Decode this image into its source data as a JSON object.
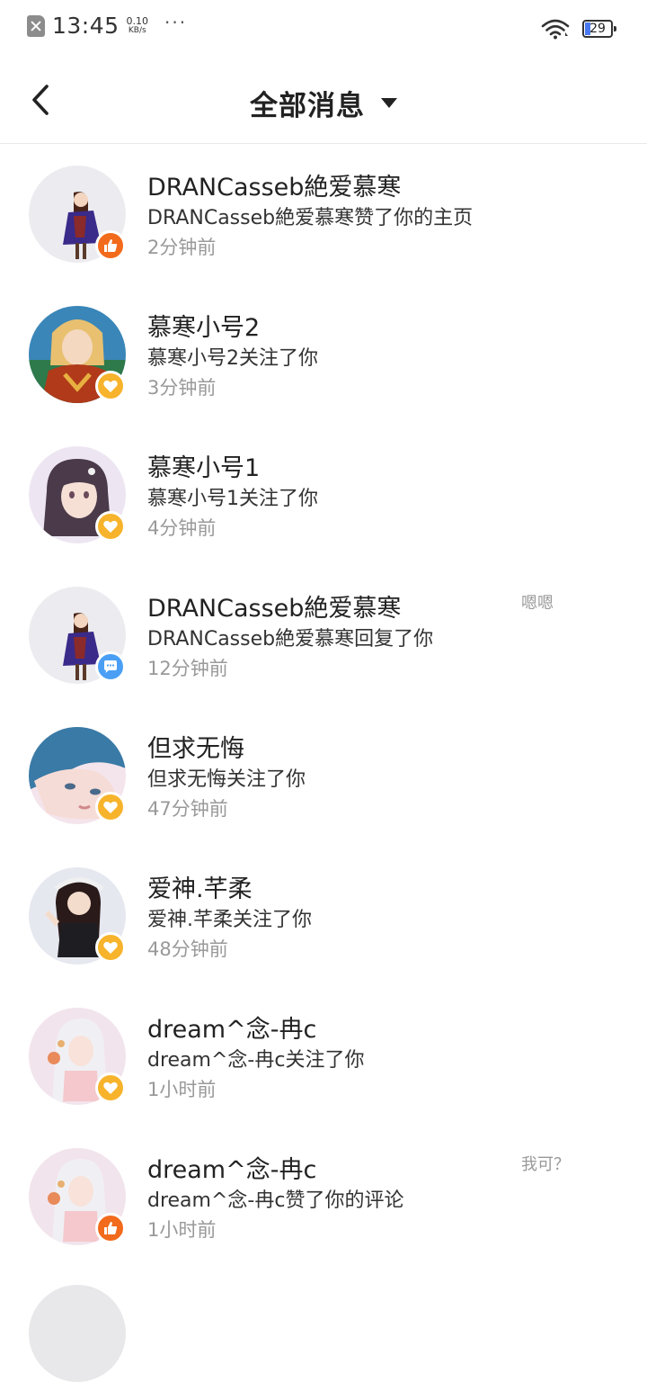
{
  "status_bar": {
    "time": "13:45",
    "net_speed_value": "0.10",
    "net_speed_unit": "KB/s",
    "more": "···",
    "battery_level": "29",
    "sim_icon": "sim-error-icon",
    "wifi_icon": "wifi-icon"
  },
  "header": {
    "title": "全部消息",
    "back_icon": "chevron-left-icon",
    "dropdown_icon": "caret-down-icon"
  },
  "colors": {
    "like_badge": "#f26a1b",
    "follow_badge": "#f7b32b",
    "reply_badge": "#4a9ff5",
    "time_text": "#999999"
  },
  "messages": [
    {
      "name": "DRANCasseb絶爱慕寒",
      "text": "DRANCasseb絶爱慕寒赞了你的主页",
      "time": "2分钟前",
      "quote": "",
      "badge": "like",
      "avatar": "anime-girl-purple-coat"
    },
    {
      "name": "慕寒小号2",
      "text": "慕寒小号2关注了你",
      "time": "3分钟前",
      "quote": "",
      "badge": "follow",
      "avatar": "blonde-warrior"
    },
    {
      "name": "慕寒小号1",
      "text": "慕寒小号1关注了你",
      "time": "4分钟前",
      "quote": "",
      "badge": "follow",
      "avatar": "dark-haired-girl"
    },
    {
      "name": "DRANCasseb絶爱慕寒",
      "text": "DRANCasseb絶爱慕寒回复了你",
      "time": "12分钟前",
      "quote": "嗯嗯",
      "badge": "reply",
      "avatar": "anime-girl-purple-coat"
    },
    {
      "name": "但求无悔",
      "text": "但求无悔关注了你",
      "time": "47分钟前",
      "quote": "",
      "badge": "follow",
      "avatar": "blue-haired-boy"
    },
    {
      "name": "爱神.芊柔",
      "text": "爱神.芊柔关注了你",
      "time": "48分钟前",
      "quote": "",
      "badge": "follow",
      "avatar": "girl-with-headphones"
    },
    {
      "name": "dream^念-冉c",
      "text": "dream^念-冉c关注了你",
      "time": "1小时前",
      "quote": "",
      "badge": "follow",
      "avatar": "white-haired-girl"
    },
    {
      "name": "dream^念-冉c",
      "text": "dream^念-冉c赞了你的评论",
      "time": "1小时前",
      "quote": "我可？",
      "badge": "like",
      "avatar": "white-haired-girl"
    }
  ]
}
